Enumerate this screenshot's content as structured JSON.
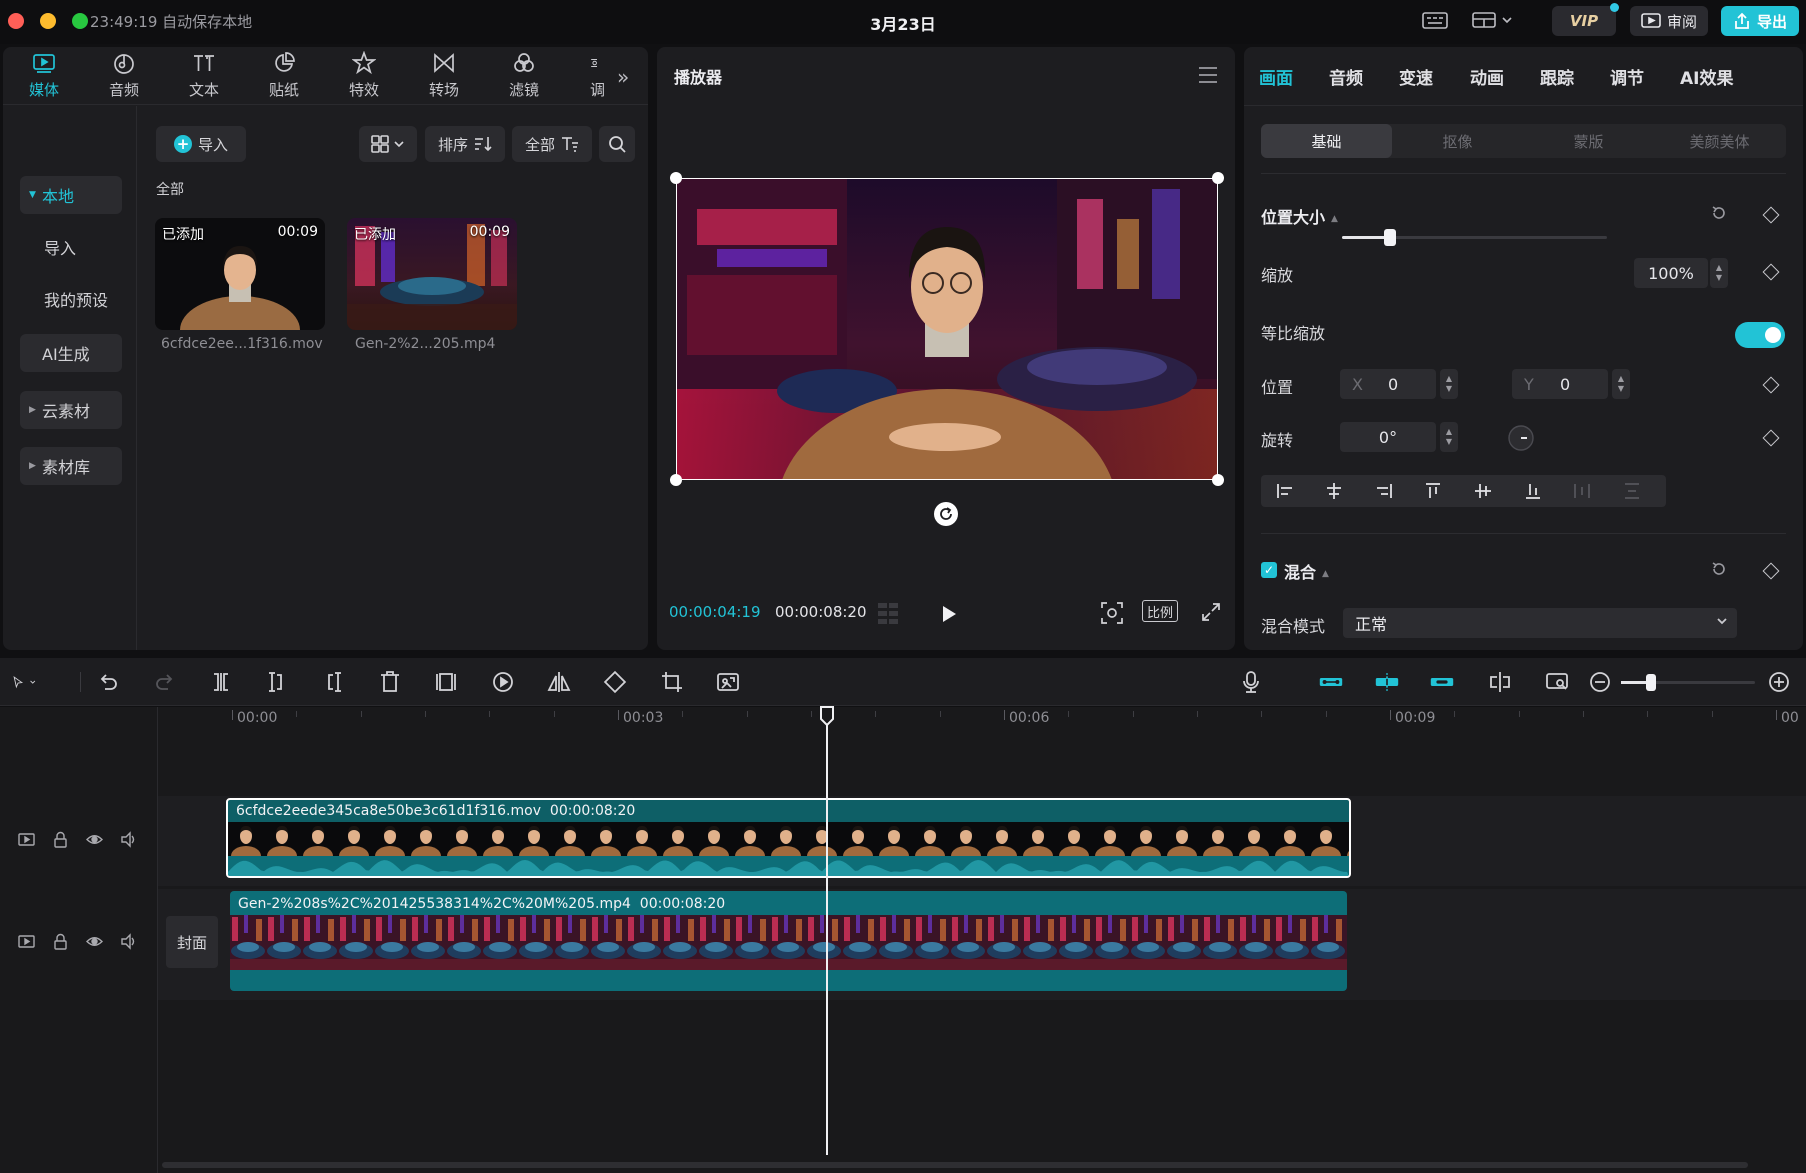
{
  "titlebar": {
    "status": "23:49:19 自动保存本地",
    "date": "3月23日",
    "vip": "VIP",
    "review": "审阅",
    "export": "导出"
  },
  "media": {
    "tabs": [
      {
        "label": "媒体",
        "icon": "media-icon",
        "active": true
      },
      {
        "label": "音频",
        "icon": "audio-icon"
      },
      {
        "label": "文本",
        "icon": "text-icon"
      },
      {
        "label": "贴纸",
        "icon": "sticker-icon"
      },
      {
        "label": "特效",
        "icon": "effects-icon"
      },
      {
        "label": "转场",
        "icon": "transition-icon"
      },
      {
        "label": "滤镜",
        "icon": "filter-icon"
      },
      {
        "label": "调",
        "icon": "adjust-icon"
      }
    ],
    "sidebar": [
      {
        "label": "本地",
        "active": true,
        "caret": true
      },
      {
        "label": "导入"
      },
      {
        "label": "我的预设"
      },
      {
        "label": "AI生成",
        "box": true
      },
      {
        "label": "云素材",
        "caret": true,
        "box": true
      },
      {
        "label": "素材库",
        "caret": true,
        "box": true
      }
    ],
    "import_label": "导入",
    "sort_label": "排序",
    "filter_label": "全部",
    "category": "全部",
    "items": [
      {
        "badge": "已添加",
        "duration": "00:09",
        "name": "6cfdce2ee...1f316.mov"
      },
      {
        "badge": "已添加",
        "duration": "00:09",
        "name": "Gen-2%2...205.mp4"
      }
    ]
  },
  "player": {
    "title": "播放器",
    "time_current": "00:00:04:19",
    "time_total": "00:00:08:20",
    "ratio_label": "比例"
  },
  "inspector": {
    "tabs": [
      "画面",
      "音频",
      "变速",
      "动画",
      "跟踪",
      "调节",
      "AI效果"
    ],
    "active_tab": "画面",
    "subtabs": [
      "基础",
      "抠像",
      "蒙版",
      "美颜美体"
    ],
    "section_position": "位置大小",
    "scale_label": "缩放",
    "scale_value": "100%",
    "scale_fraction": 0.18,
    "uniform_scale_label": "等比缩放",
    "position_label": "位置",
    "x_label": "X",
    "x_value": "0",
    "y_label": "Y",
    "y_value": "0",
    "rotation_label": "旋转",
    "rotation_value": "0°",
    "section_blend": "混合",
    "blend_mode_label": "混合模式",
    "blend_mode_value": "正常"
  },
  "timeline": {
    "ruler": [
      "00:00",
      "00:03",
      "00:06",
      "00:09",
      "00"
    ],
    "cover_label": "封面",
    "clips": [
      {
        "name": "6cfdce2eede345ca8e50be3c61d1f316.mov",
        "duration": "00:00:08:20"
      },
      {
        "name": "Gen-2%208s%2C%201425538314%2C%20M%205.mp4",
        "duration": "00:00:08:20"
      }
    ]
  },
  "colors": {
    "accent": "#22c3d6",
    "panel": "#1d1d20",
    "clip_top": "#0e5f66",
    "clip_bottom": "#0d6e78"
  }
}
